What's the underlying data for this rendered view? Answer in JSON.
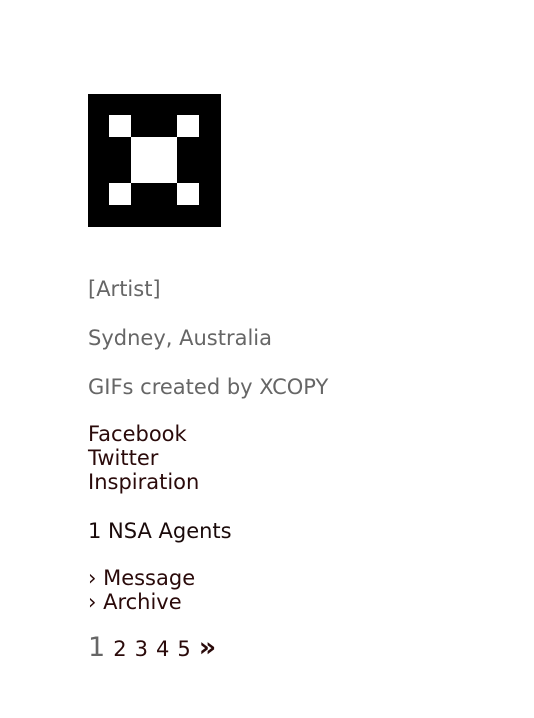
{
  "profile": {
    "logo_icon": "xcopy-x-logo",
    "role": "[Artist]",
    "location": "Sydney, Australia",
    "description": "GIFs created by XCOPY"
  },
  "links": [
    {
      "label": "Facebook"
    },
    {
      "label": "Twitter"
    },
    {
      "label": "Inspiration"
    }
  ],
  "agents": "1 NSA Agents",
  "actions": [
    {
      "label": "› Message"
    },
    {
      "label": "› Archive"
    }
  ],
  "pagination": {
    "current": "1",
    "pages": [
      "2",
      "3",
      "4",
      "5"
    ],
    "next": "»"
  },
  "colors": {
    "background": "#ffffff",
    "meta_text": "#666666",
    "link_text": "#2a0a0a",
    "logo": "#000000"
  }
}
